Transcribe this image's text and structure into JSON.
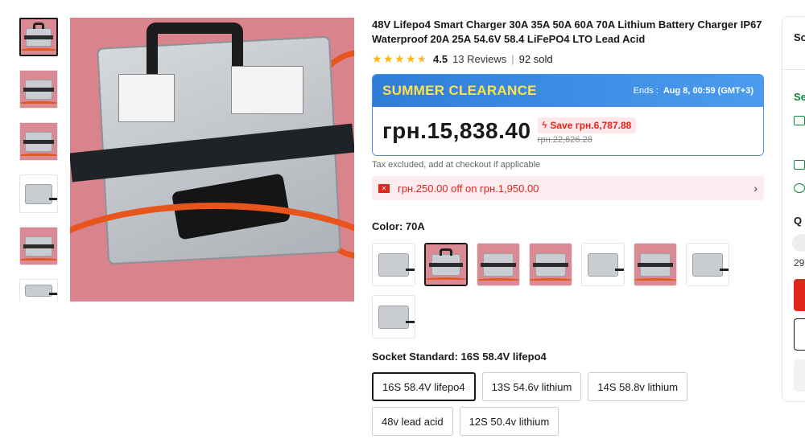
{
  "product": {
    "title": "48V Lifepo4 Smart Charger 30A 35A 50A 60A 70A Lithium Battery Charger IP67 Waterproof 20A 25A 54.6V 58.4 LiFePO4 LTO Lead Acid",
    "rating": "4.5",
    "rating_fraction": 0.9,
    "reviews": "13 Reviews",
    "sold": "92 sold",
    "rating_separator": "|"
  },
  "deal": {
    "name": "SUMMER CLEARANCE",
    "ends_label": "Ends :",
    "ends_value": "Aug 8, 00:59 (GMT+3)",
    "price": "грн.15,838.40",
    "save": "Save грн.6,787.88",
    "old_price": "грн.22,626.28",
    "color_accent": "#2f7dd8",
    "color_deal_text": "#fde24a"
  },
  "tax_note": "Tax excluded, add at checkout if applicable",
  "coupon": {
    "text": "грн.250.00 off on грн.1,950.00",
    "icon": "coupon-icon",
    "chevron": "›"
  },
  "color_attr": {
    "label": "Color: 70A",
    "swatch_count": 8,
    "selected_index": 1
  },
  "socket_attr": {
    "label": "Socket Standard: 16S 58.4V lifepo4",
    "options": [
      {
        "label": "16S 58.4V lifepo4",
        "selected": true
      },
      {
        "label": "13S 54.6v lithium",
        "selected": false
      },
      {
        "label": "14S 58.8v lithium",
        "selected": false
      },
      {
        "label": "48v lead acid",
        "selected": false
      },
      {
        "label": "12S 50.4v lithium",
        "selected": false
      }
    ]
  },
  "right_panel": {
    "so_text": "So",
    "se_text": "Se",
    "q_text": "Q",
    "qty_text": "29"
  },
  "colors": {
    "price_red": "#e1251b",
    "star": "#fdb913",
    "link_green": "#0a8a3a"
  }
}
